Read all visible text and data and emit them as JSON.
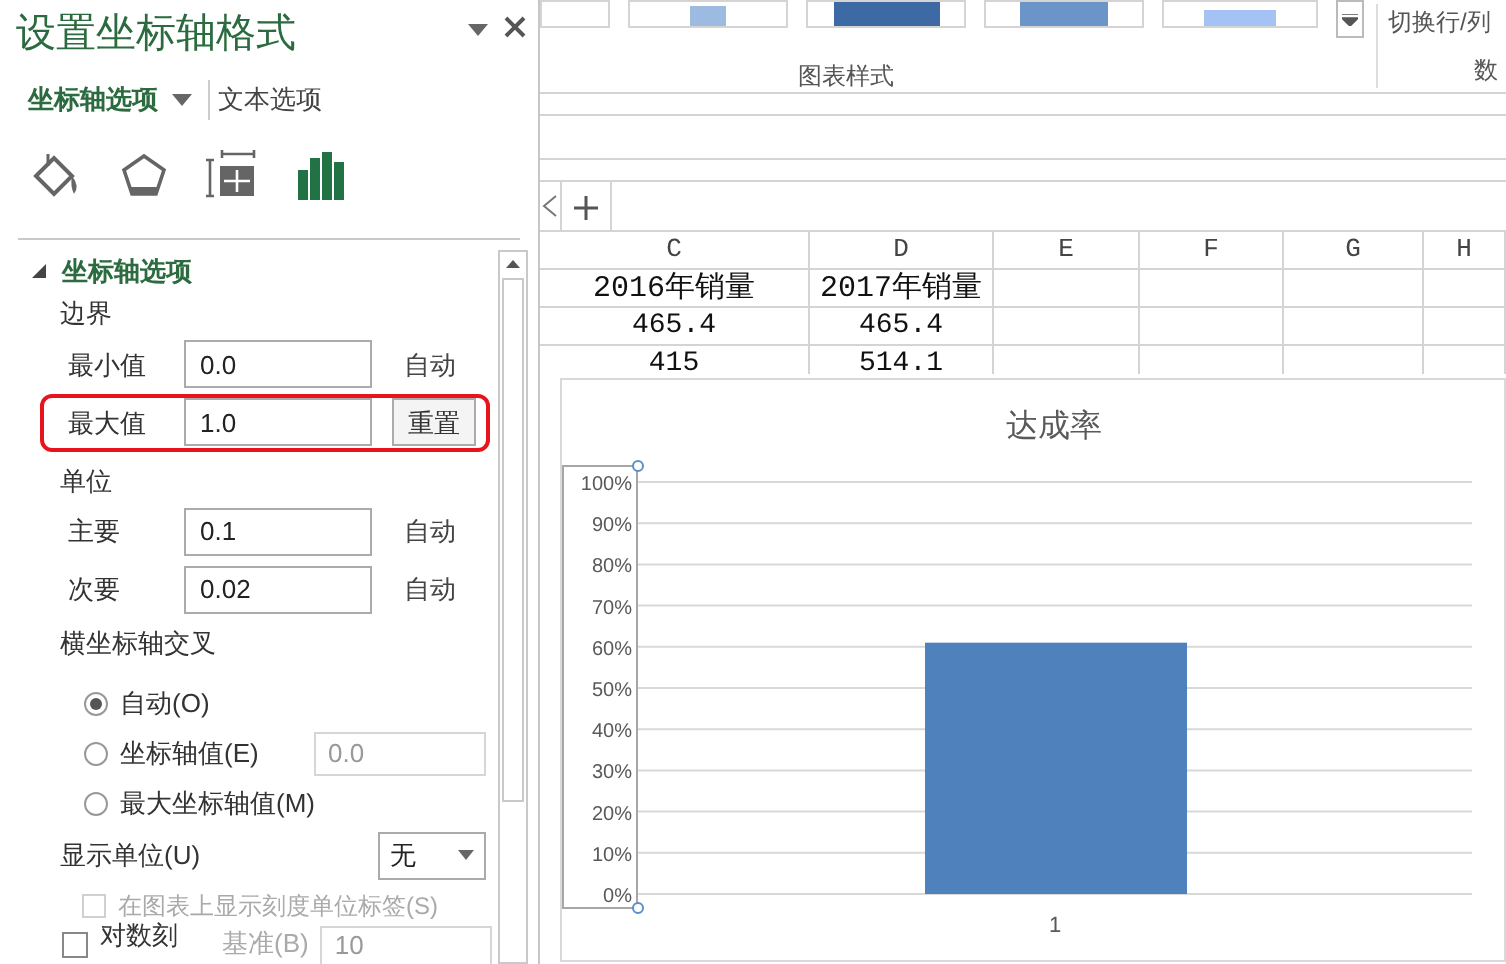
{
  "pane": {
    "title": "设置坐标轴格式",
    "tabs": [
      {
        "label": "坐标轴选项",
        "selected": true
      },
      {
        "label": "文本选项",
        "selected": false
      }
    ],
    "icon_tabs": [
      {
        "kind": "fill",
        "selected": false
      },
      {
        "kind": "effects",
        "selected": false
      },
      {
        "kind": "size",
        "selected": false
      },
      {
        "kind": "axis",
        "selected": true
      }
    ],
    "section": {
      "title": "坐标轴选项",
      "expanded": true
    },
    "bounds": {
      "label": "边界",
      "rows": [
        {
          "label": "最小值",
          "value": "0.0",
          "button": "自动",
          "highlighted": false
        },
        {
          "label": "最大值",
          "value": "1.0",
          "button": "重置",
          "highlighted": true
        }
      ]
    },
    "units": {
      "label": "单位",
      "rows": [
        {
          "label": "主要",
          "value": "0.1",
          "button": "自动",
          "highlighted": false
        },
        {
          "label": "次要",
          "value": "0.02",
          "button": "自动",
          "highlighted": false
        }
      ]
    },
    "crosses": {
      "label": "横坐标轴交叉",
      "options": [
        {
          "label": "自动(O)",
          "selected": true
        },
        {
          "label": "坐标轴值(E)",
          "selected": false,
          "value": "0.0",
          "disabled": true
        },
        {
          "label": "最大坐标轴值(M)",
          "selected": false
        }
      ]
    },
    "display_units": {
      "label": "显示单位(U)",
      "value": "无"
    },
    "show_label": {
      "label": "在图表上显示刻度单位标签(S)",
      "checked": false,
      "disabled": true
    },
    "log_scale": {
      "label": "对数刻",
      "checked": false,
      "base_label": "基准(B)",
      "base_value": "10"
    }
  },
  "ribbon": {
    "top_button": "切换行/列",
    "group_label": "图表样式",
    "group_label_2": "数"
  },
  "sheet": {
    "columns": [
      "C",
      "D",
      "E",
      "F",
      "G",
      "H"
    ],
    "rows": [
      [
        "2016年销量",
        "2017年销量"
      ],
      [
        "465.4",
        "465.4"
      ],
      [
        "415",
        "514.1"
      ]
    ]
  },
  "chart": {
    "chart_data": {
      "type": "bar",
      "title": "达成率",
      "categories": [
        "1"
      ],
      "values": [
        0.61
      ],
      "ylim": [
        0,
        1
      ],
      "yticks": [
        {
          "value": 0,
          "label": "0%"
        },
        {
          "value": 0.1,
          "label": "10%"
        },
        {
          "value": 0.2,
          "label": "20%"
        },
        {
          "value": 0.3,
          "label": "30%"
        },
        {
          "value": 0.4,
          "label": "40%"
        },
        {
          "value": 0.5,
          "label": "50%"
        },
        {
          "value": 0.6,
          "label": "60%"
        },
        {
          "value": 0.7,
          "label": "70%"
        },
        {
          "value": 0.8,
          "label": "80%"
        },
        {
          "value": 0.9,
          "label": "90%"
        },
        {
          "value": 1,
          "label": "100%"
        }
      ],
      "grid": true
    }
  }
}
